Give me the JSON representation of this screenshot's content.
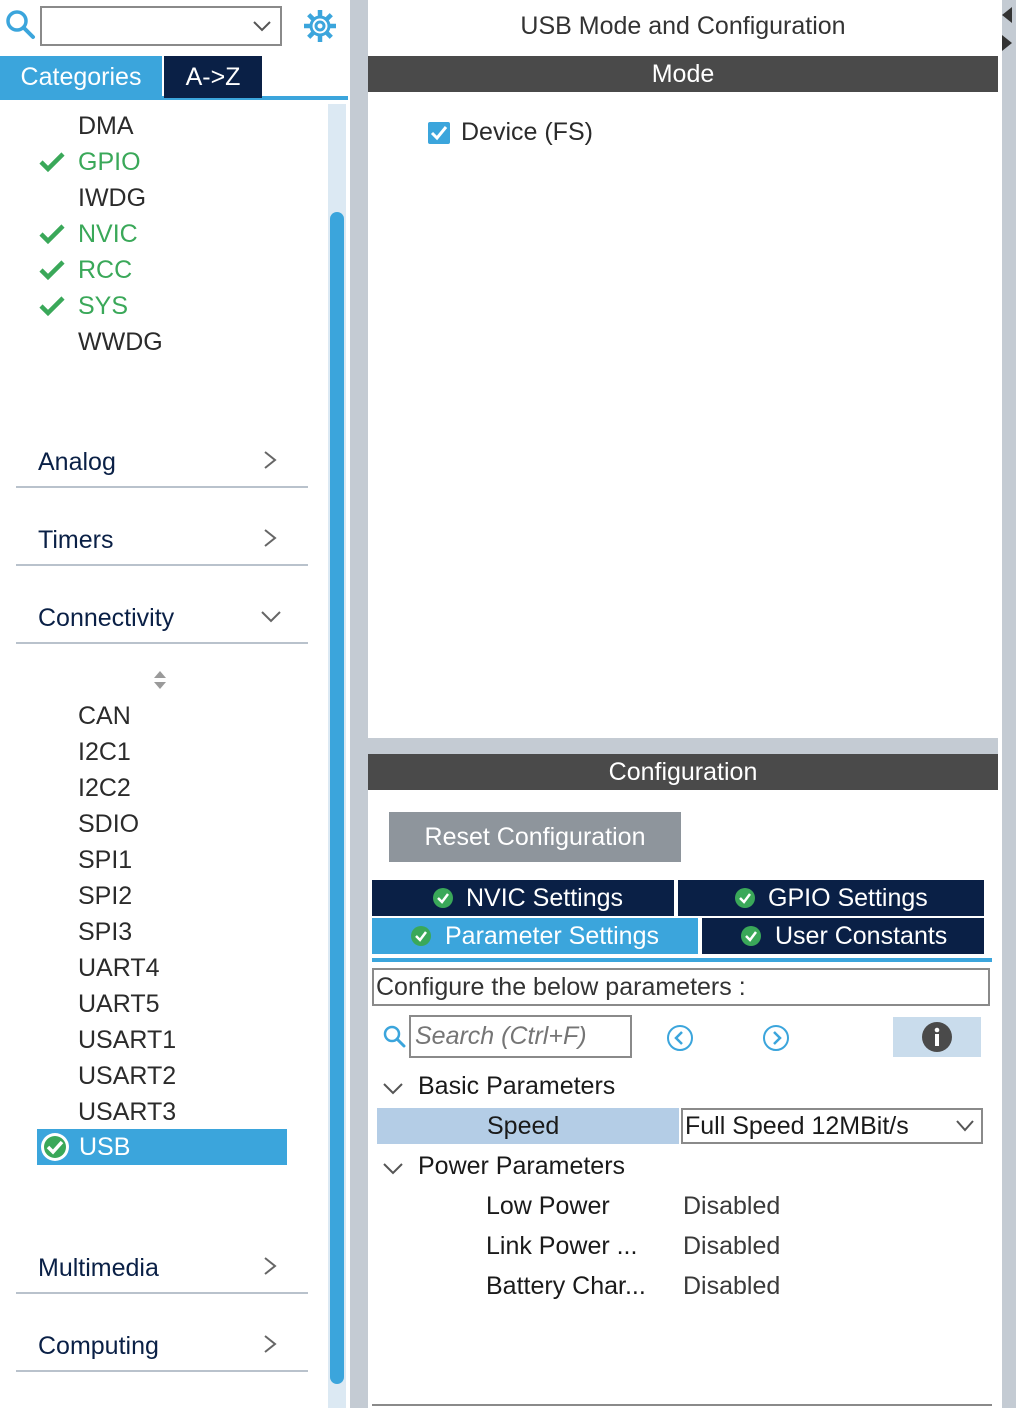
{
  "sidebar": {
    "search_value": "",
    "tabs": {
      "categories": "Categories",
      "az": "A->Z"
    },
    "system_items": [
      {
        "label": "DMA",
        "checked": false
      },
      {
        "label": "GPIO",
        "checked": true
      },
      {
        "label": "IWDG",
        "checked": false
      },
      {
        "label": "NVIC",
        "checked": true
      },
      {
        "label": "RCC",
        "checked": true
      },
      {
        "label": "SYS",
        "checked": true
      },
      {
        "label": "WWDG",
        "checked": false
      }
    ],
    "categories": {
      "analog": "Analog",
      "timers": "Timers",
      "connectivity": "Connectivity",
      "multimedia": "Multimedia",
      "computing": "Computing"
    },
    "connectivity_items": [
      "CAN",
      "I2C1",
      "I2C2",
      "SDIO",
      "SPI1",
      "SPI2",
      "SPI3",
      "UART4",
      "UART5",
      "USART1",
      "USART2",
      "USART3"
    ],
    "selected_item": "USB"
  },
  "panel": {
    "title": "USB Mode and Configuration",
    "mode_header": "Mode",
    "mode_option": {
      "label": "Device (FS)",
      "checked": true
    },
    "config_header": "Configuration",
    "reset_button": "Reset Configuration",
    "tabs": {
      "nvic": "NVIC Settings",
      "gpio": "GPIO Settings",
      "parameters": "Parameter Settings",
      "user_constants": "User Constants"
    },
    "description": "Configure the below parameters :",
    "search_placeholder": "Search (Ctrl+F)",
    "basic_group": "Basic Parameters",
    "speed": {
      "label": "Speed",
      "value": "Full Speed 12MBit/s"
    },
    "power_group": "Power Parameters",
    "power_params": [
      {
        "name": "Low Power",
        "value": "Disabled"
      },
      {
        "name": "Link Power ...",
        "value": "Disabled"
      },
      {
        "name": "Battery Char...",
        "value": "Disabled"
      }
    ]
  },
  "colors": {
    "accent": "#3ba5dc",
    "navy": "#0a2046",
    "check_green": "#3aa859",
    "header_gray": "#4a4a4a"
  }
}
